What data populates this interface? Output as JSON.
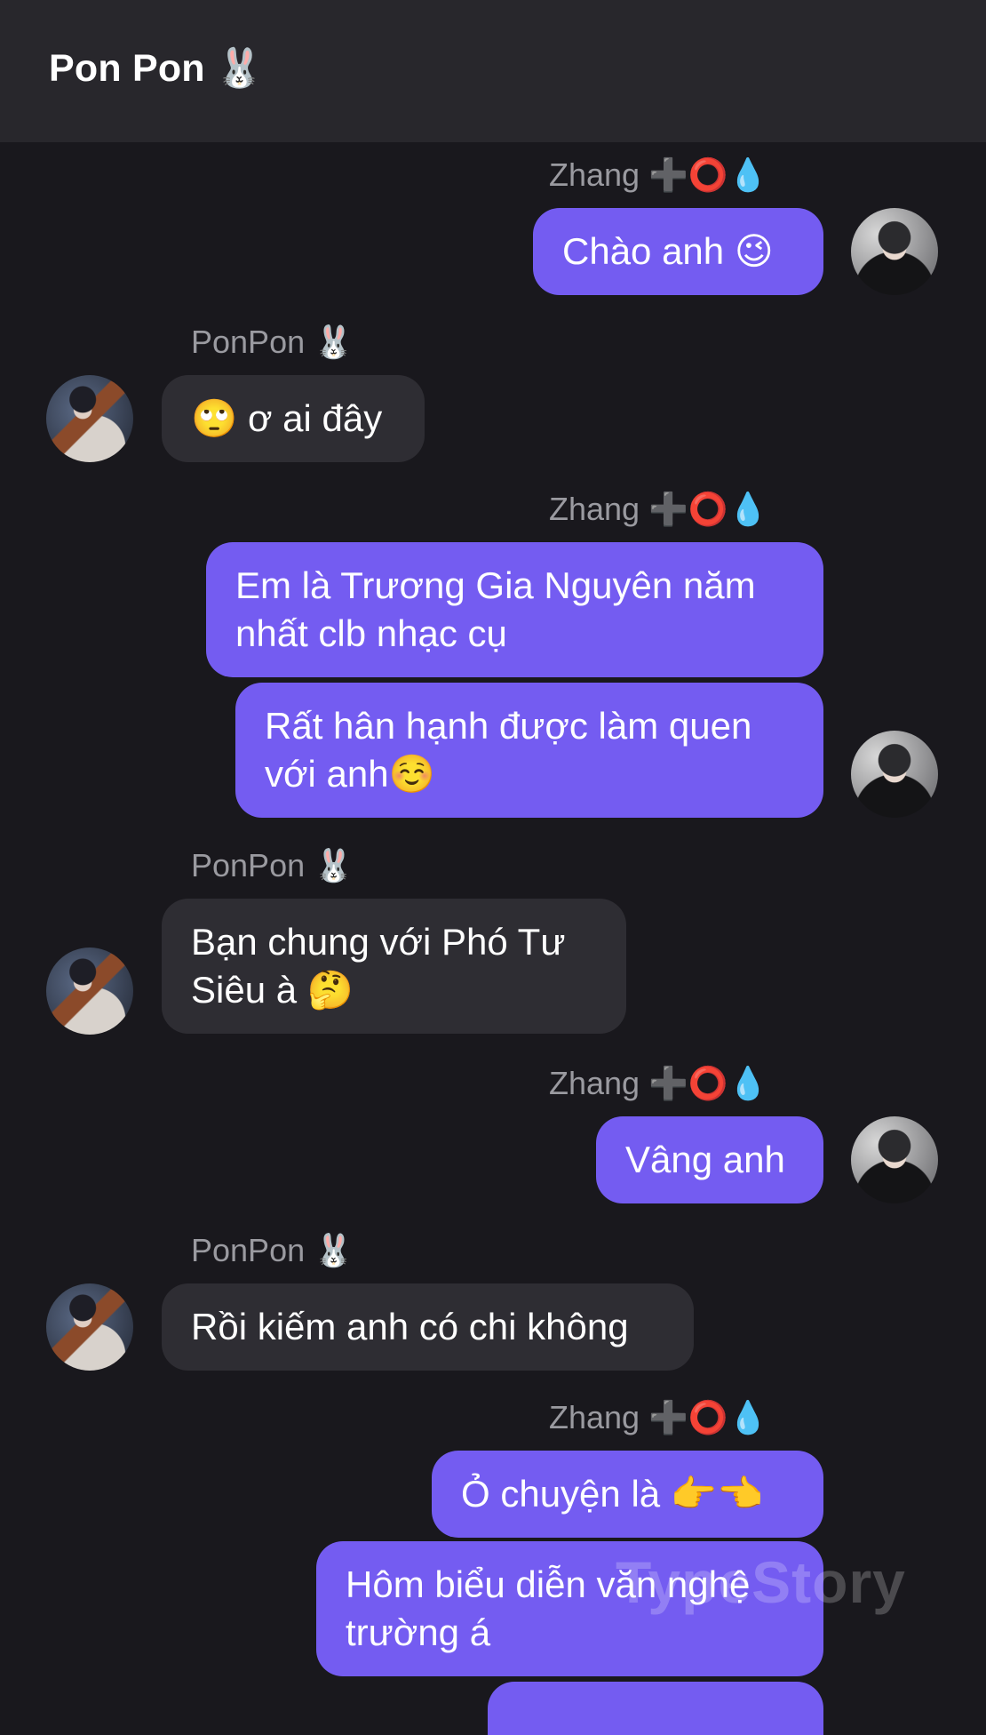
{
  "header": {
    "title": "Pon Pon 🐰"
  },
  "messages": [
    {
      "sender": "Zhang ➕⭕💧",
      "text": "Chào anh 😉"
    },
    {
      "sender": "PonPon 🐰",
      "text": "🙄 ơ ai đây"
    },
    {
      "sender": "Zhang ➕⭕💧",
      "text": "Em là Trương Gia Nguyên năm\nnhất clb nhạc cụ"
    },
    {
      "text": "Rất hân hạnh được làm quen\nvới anh☺️"
    },
    {
      "sender": "PonPon 🐰",
      "text": "Bạn chung với Phó Tư\nSiêu à 🤔"
    },
    {
      "sender": "Zhang ➕⭕💧",
      "text": "Vâng anh"
    },
    {
      "sender": "PonPon 🐰",
      "text": "Rồi kiếm anh có chi không"
    },
    {
      "sender": "Zhang ➕⭕💧",
      "text": "Ỏ chuyện là 👉👈"
    },
    {
      "text": "Hôm biểu diễn văn nghệ\ntrường á"
    }
  ],
  "watermark": "TypeStory",
  "colors": {
    "header_bg": "#28272c",
    "chat_bg": "#19181d",
    "outgoing_bubble": "#745cf1",
    "incoming_bubble": "#2e2d33",
    "name_label": "#9a9aa0"
  }
}
